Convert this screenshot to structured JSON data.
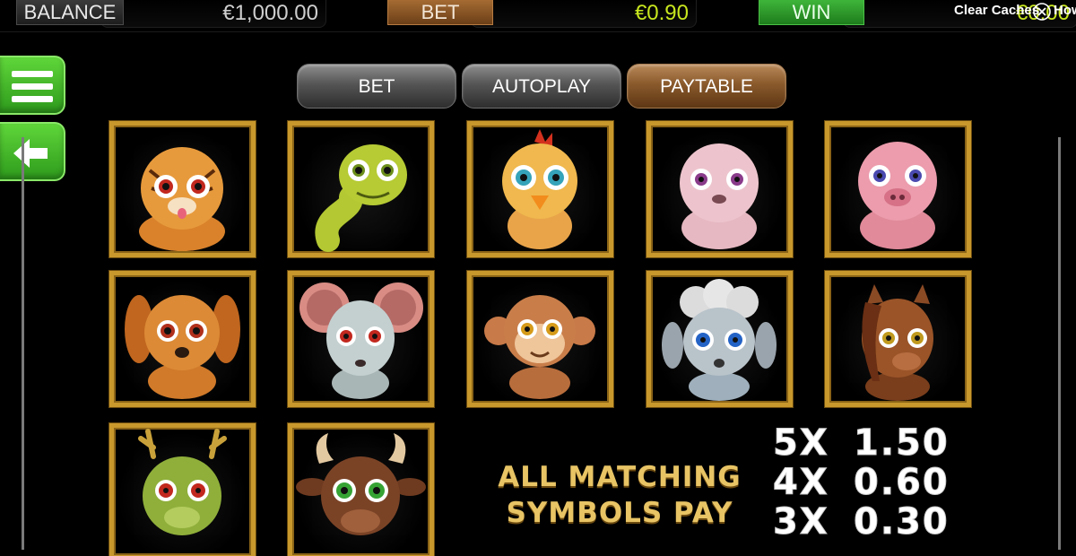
{
  "topbar": {
    "balance_label": "BALANCE",
    "balance_value": "€1,000.00",
    "bet_label": "BET",
    "bet_value": "€0.90",
    "win_label": "WIN",
    "win_value": "€0.00",
    "clear_caches": "Clear Caches",
    "how_link": "How"
  },
  "side": {
    "menu_icon": "hamburger-menu-icon",
    "back_icon": "arrow-left-icon"
  },
  "tabs": [
    {
      "label": "BET",
      "active": false
    },
    {
      "label": "AUTOPLAY",
      "active": false
    },
    {
      "label": "PAYTABLE",
      "active": true
    }
  ],
  "symbols": [
    {
      "name": "tiger"
    },
    {
      "name": "snake"
    },
    {
      "name": "rooster"
    },
    {
      "name": "pig-pink"
    },
    {
      "name": "pig"
    },
    {
      "name": "dog"
    },
    {
      "name": "rat"
    },
    {
      "name": "monkey"
    },
    {
      "name": "sheep"
    },
    {
      "name": "horse"
    },
    {
      "name": "dragon"
    },
    {
      "name": "ox"
    }
  ],
  "paytable": {
    "caption_line1": "ALL MATCHING",
    "caption_line2": "SYMBOLS PAY",
    "rows": [
      {
        "count": "5X",
        "value": "1.50"
      },
      {
        "count": "4X",
        "value": "0.60"
      },
      {
        "count": "3X",
        "value": "0.30"
      }
    ]
  },
  "colors": {
    "gold_frame": "#c8982c",
    "win_green": "#c8e61e",
    "side_button_green": "#3fb526",
    "paytable_tab_brown": "#8a5a2c"
  }
}
